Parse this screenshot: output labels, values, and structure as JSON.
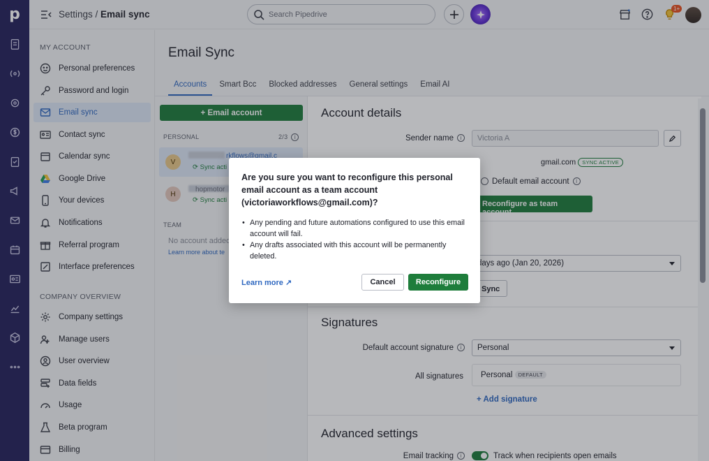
{
  "app": {
    "logo": "p"
  },
  "topbar": {
    "breadcrumb_parent": "Settings",
    "breadcrumb_sep": " / ",
    "breadcrumb_current": "Email sync",
    "search_placeholder": "Search Pipedrive",
    "notification_badge": "1+"
  },
  "sidebar": {
    "my_account_title": "MY ACCOUNT",
    "my_account_items": [
      {
        "label": "Personal preferences",
        "icon": "smiley-icon"
      },
      {
        "label": "Password and login",
        "icon": "key-icon"
      },
      {
        "label": "Email sync",
        "icon": "mail-icon"
      },
      {
        "label": "Contact sync",
        "icon": "contact-card-icon"
      },
      {
        "label": "Calendar sync",
        "icon": "calendar-icon"
      },
      {
        "label": "Google Drive",
        "icon": "google-drive-icon"
      },
      {
        "label": "Your devices",
        "icon": "phone-icon"
      },
      {
        "label": "Notifications",
        "icon": "bell-icon"
      },
      {
        "label": "Referral program",
        "icon": "gift-icon"
      },
      {
        "label": "Interface preferences",
        "icon": "interface-icon"
      }
    ],
    "company_title": "COMPANY OVERVIEW",
    "company_items": [
      {
        "label": "Company settings",
        "icon": "gear-icon"
      },
      {
        "label": "Manage users",
        "icon": "users-icon"
      },
      {
        "label": "User overview",
        "icon": "user-circle-icon"
      },
      {
        "label": "Data fields",
        "icon": "data-fields-icon"
      },
      {
        "label": "Usage",
        "icon": "gauge-icon"
      },
      {
        "label": "Beta program",
        "icon": "flask-icon"
      },
      {
        "label": "Billing",
        "icon": "credit-card-icon"
      }
    ]
  },
  "main": {
    "title": "Email Sync",
    "tabs": [
      "Accounts",
      "Smart Bcc",
      "Blocked addresses",
      "General settings",
      "Email AI"
    ],
    "add_button": "+   Email account",
    "personal_label": "PERSONAL",
    "personal_count": "2/3",
    "accounts": [
      {
        "avatar": "V",
        "email_fragment": "rkflows@gmail.c",
        "sync": "Sync acti"
      },
      {
        "avatar": "H",
        "email_fragment": "hopmotor",
        "sync": "Sync acti"
      }
    ],
    "team_label": "TEAM",
    "no_account": "No account added",
    "learn_more_small": "Learn more about te"
  },
  "details": {
    "heading": "Account details",
    "sender_name_label": "Sender name",
    "sender_name_value": "Victoria A",
    "email_suffix": "gmail.com",
    "sync_active_badge": "SYNC ACTIVE",
    "default_email_label": "Default email account",
    "reconfigure_team_btn": "Reconfigure as team account",
    "sync_period_value": "days ago (Jan 20, 2026)",
    "sync_btn": "Sync",
    "signatures_heading": "Signatures",
    "default_sig_label": "Default account signature",
    "default_sig_value": "Personal",
    "all_sig_label": "All signatures",
    "all_sig_value": "Personal",
    "default_badge": "DEFAULT",
    "add_signature": "+  Add signature",
    "advanced_heading": "Advanced settings",
    "email_tracking_label": "Email tracking",
    "track_text": "Track when recipients open emails"
  },
  "modal": {
    "title": "Are you sure you want to reconfigure this personal email account as a team account (victoriaworkflows@gmail.com)?",
    "bullets": [
      "Any pending and future automations configured to use this email account will fail.",
      "Any drafts associated with this account will be permanently deleted."
    ],
    "learn_more": "Learn more ↗",
    "cancel": "Cancel",
    "confirm": "Reconfigure"
  },
  "colors": {
    "rail": "#26235c",
    "accent": "#2f68c0",
    "primary_green": "#1e7d3b"
  }
}
